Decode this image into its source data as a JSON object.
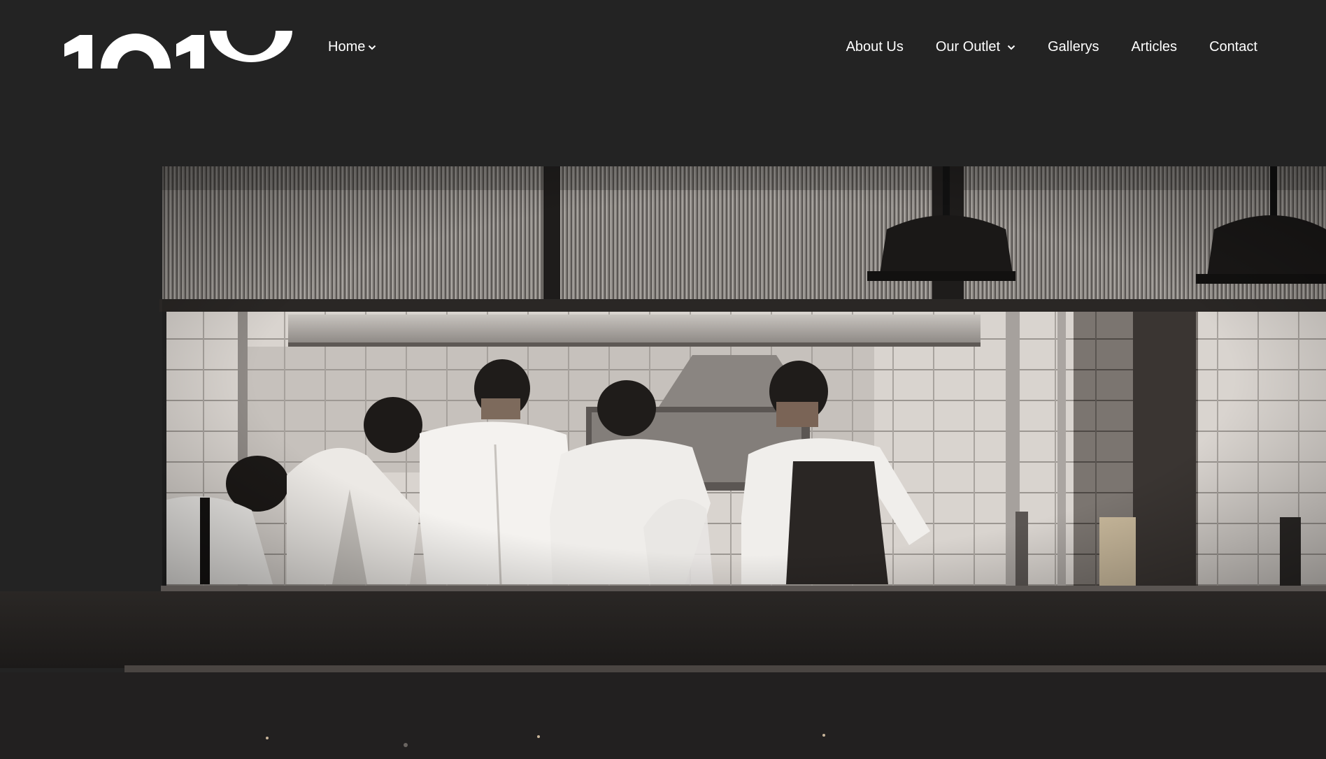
{
  "brand": {
    "logo_text": "1010"
  },
  "nav": {
    "home": "Home",
    "items": [
      {
        "label": "About Us",
        "has_dropdown": false
      },
      {
        "label": "Our Outlet",
        "has_dropdown": true
      },
      {
        "label": "Gallerys",
        "has_dropdown": false
      },
      {
        "label": "Articles",
        "has_dropdown": false
      },
      {
        "label": "Contact",
        "has_dropdown": false
      }
    ]
  },
  "hero": {
    "image_subject": "chefs-in-kitchen-photo"
  },
  "colors": {
    "background": "#232323",
    "text": "#ffffff"
  },
  "icons": {
    "dropdown": "chevron-down-icon"
  }
}
